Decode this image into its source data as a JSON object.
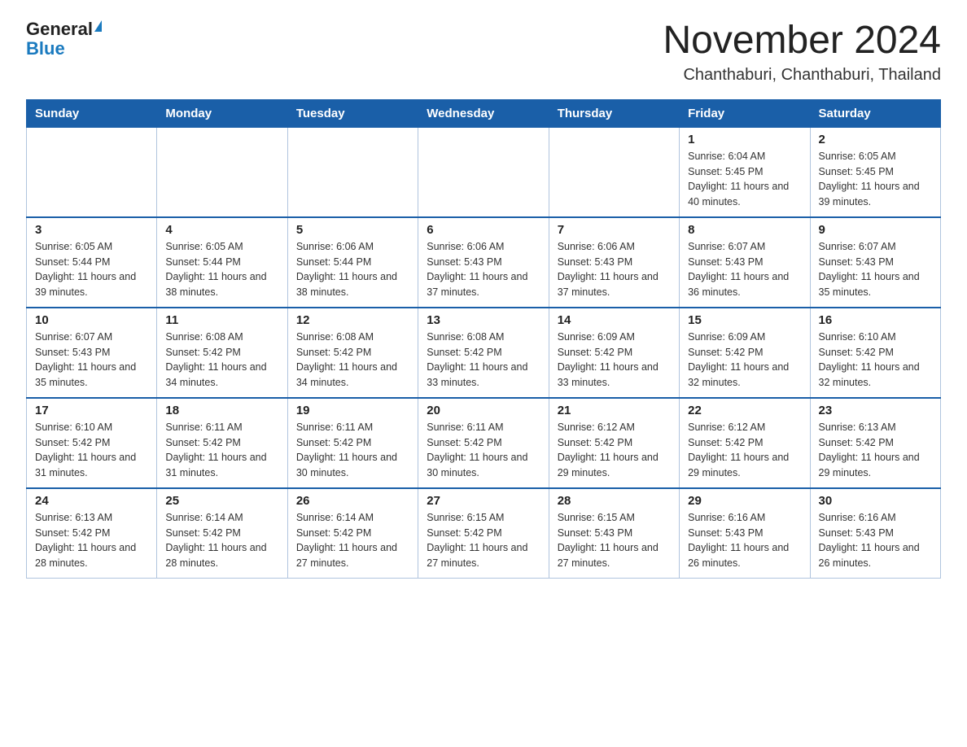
{
  "logo": {
    "general": "General",
    "blue": "Blue",
    "triangle": "▲"
  },
  "title": "November 2024",
  "location": "Chanthaburi, Chanthaburi, Thailand",
  "days_of_week": [
    "Sunday",
    "Monday",
    "Tuesday",
    "Wednesday",
    "Thursday",
    "Friday",
    "Saturday"
  ],
  "weeks": [
    [
      {
        "day": "",
        "info": ""
      },
      {
        "day": "",
        "info": ""
      },
      {
        "day": "",
        "info": ""
      },
      {
        "day": "",
        "info": ""
      },
      {
        "day": "",
        "info": ""
      },
      {
        "day": "1",
        "info": "Sunrise: 6:04 AM\nSunset: 5:45 PM\nDaylight: 11 hours and 40 minutes."
      },
      {
        "day": "2",
        "info": "Sunrise: 6:05 AM\nSunset: 5:45 PM\nDaylight: 11 hours and 39 minutes."
      }
    ],
    [
      {
        "day": "3",
        "info": "Sunrise: 6:05 AM\nSunset: 5:44 PM\nDaylight: 11 hours and 39 minutes."
      },
      {
        "day": "4",
        "info": "Sunrise: 6:05 AM\nSunset: 5:44 PM\nDaylight: 11 hours and 38 minutes."
      },
      {
        "day": "5",
        "info": "Sunrise: 6:06 AM\nSunset: 5:44 PM\nDaylight: 11 hours and 38 minutes."
      },
      {
        "day": "6",
        "info": "Sunrise: 6:06 AM\nSunset: 5:43 PM\nDaylight: 11 hours and 37 minutes."
      },
      {
        "day": "7",
        "info": "Sunrise: 6:06 AM\nSunset: 5:43 PM\nDaylight: 11 hours and 37 minutes."
      },
      {
        "day": "8",
        "info": "Sunrise: 6:07 AM\nSunset: 5:43 PM\nDaylight: 11 hours and 36 minutes."
      },
      {
        "day": "9",
        "info": "Sunrise: 6:07 AM\nSunset: 5:43 PM\nDaylight: 11 hours and 35 minutes."
      }
    ],
    [
      {
        "day": "10",
        "info": "Sunrise: 6:07 AM\nSunset: 5:43 PM\nDaylight: 11 hours and 35 minutes."
      },
      {
        "day": "11",
        "info": "Sunrise: 6:08 AM\nSunset: 5:42 PM\nDaylight: 11 hours and 34 minutes."
      },
      {
        "day": "12",
        "info": "Sunrise: 6:08 AM\nSunset: 5:42 PM\nDaylight: 11 hours and 34 minutes."
      },
      {
        "day": "13",
        "info": "Sunrise: 6:08 AM\nSunset: 5:42 PM\nDaylight: 11 hours and 33 minutes."
      },
      {
        "day": "14",
        "info": "Sunrise: 6:09 AM\nSunset: 5:42 PM\nDaylight: 11 hours and 33 minutes."
      },
      {
        "day": "15",
        "info": "Sunrise: 6:09 AM\nSunset: 5:42 PM\nDaylight: 11 hours and 32 minutes."
      },
      {
        "day": "16",
        "info": "Sunrise: 6:10 AM\nSunset: 5:42 PM\nDaylight: 11 hours and 32 minutes."
      }
    ],
    [
      {
        "day": "17",
        "info": "Sunrise: 6:10 AM\nSunset: 5:42 PM\nDaylight: 11 hours and 31 minutes."
      },
      {
        "day": "18",
        "info": "Sunrise: 6:11 AM\nSunset: 5:42 PM\nDaylight: 11 hours and 31 minutes."
      },
      {
        "day": "19",
        "info": "Sunrise: 6:11 AM\nSunset: 5:42 PM\nDaylight: 11 hours and 30 minutes."
      },
      {
        "day": "20",
        "info": "Sunrise: 6:11 AM\nSunset: 5:42 PM\nDaylight: 11 hours and 30 minutes."
      },
      {
        "day": "21",
        "info": "Sunrise: 6:12 AM\nSunset: 5:42 PM\nDaylight: 11 hours and 29 minutes."
      },
      {
        "day": "22",
        "info": "Sunrise: 6:12 AM\nSunset: 5:42 PM\nDaylight: 11 hours and 29 minutes."
      },
      {
        "day": "23",
        "info": "Sunrise: 6:13 AM\nSunset: 5:42 PM\nDaylight: 11 hours and 29 minutes."
      }
    ],
    [
      {
        "day": "24",
        "info": "Sunrise: 6:13 AM\nSunset: 5:42 PM\nDaylight: 11 hours and 28 minutes."
      },
      {
        "day": "25",
        "info": "Sunrise: 6:14 AM\nSunset: 5:42 PM\nDaylight: 11 hours and 28 minutes."
      },
      {
        "day": "26",
        "info": "Sunrise: 6:14 AM\nSunset: 5:42 PM\nDaylight: 11 hours and 27 minutes."
      },
      {
        "day": "27",
        "info": "Sunrise: 6:15 AM\nSunset: 5:42 PM\nDaylight: 11 hours and 27 minutes."
      },
      {
        "day": "28",
        "info": "Sunrise: 6:15 AM\nSunset: 5:43 PM\nDaylight: 11 hours and 27 minutes."
      },
      {
        "day": "29",
        "info": "Sunrise: 6:16 AM\nSunset: 5:43 PM\nDaylight: 11 hours and 26 minutes."
      },
      {
        "day": "30",
        "info": "Sunrise: 6:16 AM\nSunset: 5:43 PM\nDaylight: 11 hours and 26 minutes."
      }
    ]
  ]
}
